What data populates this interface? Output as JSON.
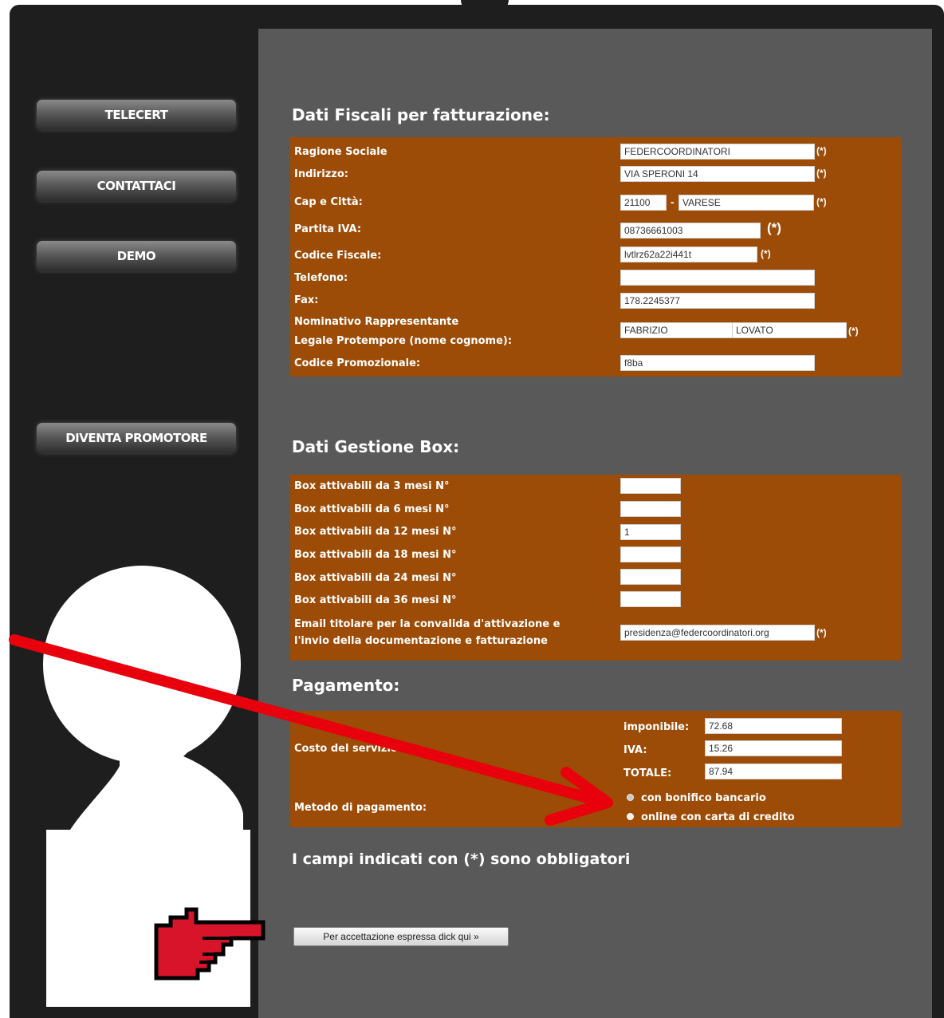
{
  "sidebar": {
    "items": [
      {
        "label": "TELECERT"
      },
      {
        "label": "CONTATTACI"
      },
      {
        "label": "DEMO"
      },
      {
        "label": "DIVENTA PROMOTORE"
      }
    ]
  },
  "fiscal": {
    "title": "Dati Fiscali per fatturazione:",
    "ragione_label": "Ragione Sociale",
    "ragione_value": "FEDERCOORDINATORI",
    "indirizzo_label": "Indirizzo:",
    "indirizzo_value": "VIA SPERONI 14",
    "cap_label": "Cap e Città:",
    "cap_value": "21100",
    "citta_value": "VARESE",
    "piva_label": "Partita IVA:",
    "piva_value": "08736661003",
    "cf_label": "Codice Fiscale:",
    "cf_value": "lvtlrz62a22i441t",
    "telefono_label": "Telefono:",
    "telefono_value": "",
    "fax_label": "Fax:",
    "fax_value": "178.2245377",
    "nominativo_label_1": "Nominativo Rappresentante",
    "nominativo_label_2": "Legale Protempore (nome cognome):",
    "nome_value": "FABRIZIO",
    "cognome_value": "LOVATO",
    "promo_label": "Codice Promozionale:",
    "promo_value": "f8ba",
    "required_mark": "(*)",
    "dash": "-"
  },
  "box": {
    "title": "Dati Gestione Box:",
    "rows": [
      {
        "label": "Box attivabili da 3 mesi N°",
        "value": ""
      },
      {
        "label": "Box attivabili da 6 mesi N°",
        "value": ""
      },
      {
        "label": "Box attivabili da 12 mesi N°",
        "value": "1"
      },
      {
        "label": "Box attivabili da 18 mesi N°",
        "value": ""
      },
      {
        "label": "Box attivabili da 24 mesi N°",
        "value": ""
      },
      {
        "label": "Box attivabili da 36 mesi N°",
        "value": ""
      }
    ],
    "email_label_1": "Email titolare per la convalida d'attivazione e",
    "email_label_2": "l'invio della documentazione e fatturazione",
    "email_value": "presidenza@federcoordinatori.org"
  },
  "payment": {
    "title": "Pagamento:",
    "costo_label": "Costo del servizio:",
    "imponibile_label": "imponibile:",
    "imponibile_value": "72.68",
    "iva_label": "IVA:",
    "iva_value": "15.26",
    "totale_label": "TOTALE:",
    "totale_value": "87.94",
    "metodo_label": "Metodo di pagamento:",
    "option_bonifico": "con bonifico bancario",
    "option_carta": "online con carta di credito",
    "selected": "online con carta di credito"
  },
  "required_note": "I campi indicati con (*) sono obbligatori",
  "accept_button": "Per accettazione espressa dick qui »",
  "colors": {
    "frame": "#1e1e1e",
    "main_bg": "#595959",
    "panel": "#9c4c06",
    "arrow": "#e8000c",
    "hand": "#d8142a"
  }
}
